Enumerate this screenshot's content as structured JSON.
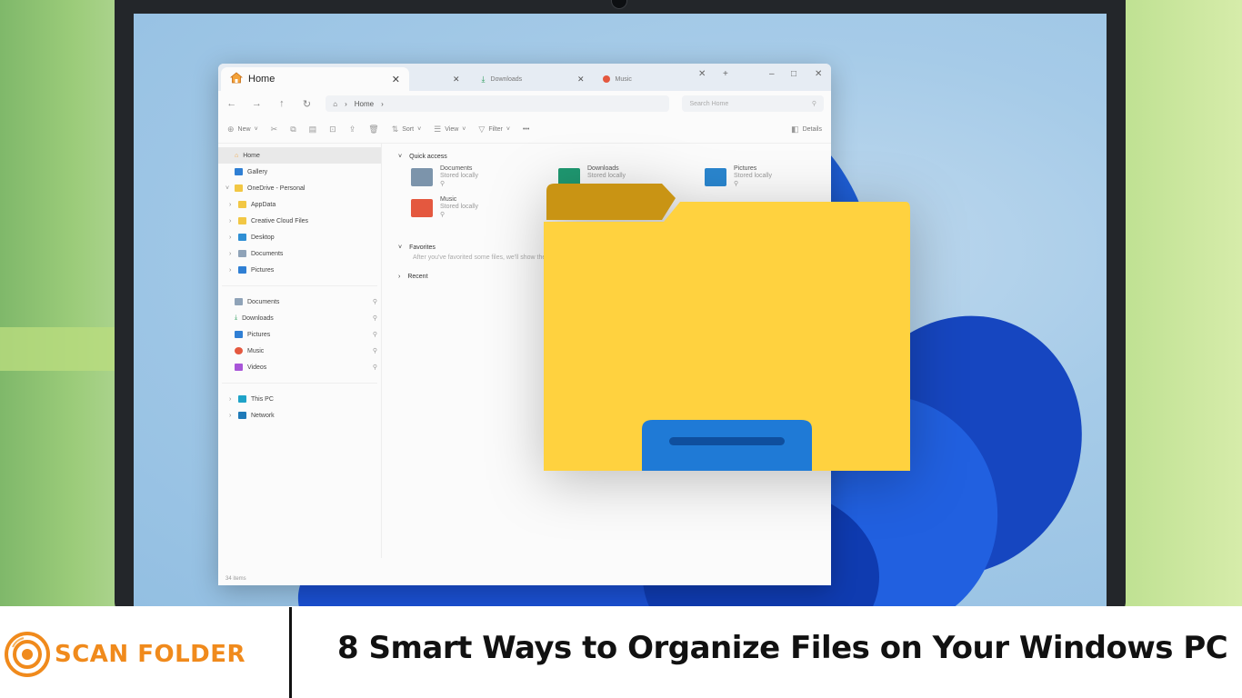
{
  "explorer": {
    "tabs": [
      {
        "label": "Home",
        "active": true
      },
      {
        "label": "Downloads"
      },
      {
        "label": "Music"
      }
    ],
    "window_controls": {
      "minimize": "–",
      "maximize": "□",
      "close": "✕"
    },
    "address": {
      "root": "Home"
    },
    "search_placeholder": "Search Home",
    "commands": {
      "new": "New",
      "sort": "Sort",
      "view": "View",
      "filter": "Filter",
      "more": "•••",
      "details": "Details"
    },
    "nav": {
      "home": "Home",
      "gallery": "Gallery",
      "onedrive": "OneDrive - Personal",
      "appdata": "AppData",
      "creative_cloud": "Creative Cloud Files",
      "desktop": "Desktop",
      "documents": "Documents",
      "pictures": "Pictures",
      "pinned": [
        "Documents",
        "Downloads",
        "Pictures",
        "Music",
        "Videos"
      ],
      "this_pc": "This PC",
      "network": "Network"
    },
    "content": {
      "quick_access": "Quick access",
      "items": [
        {
          "name": "Documents",
          "sub": "Stored locally"
        },
        {
          "name": "Downloads",
          "sub": "Stored locally"
        },
        {
          "name": "Pictures",
          "sub": "Stored locally"
        },
        {
          "name": "Music",
          "sub": "Stored locally"
        }
      ],
      "favorites": "Favorites",
      "favorites_hint": "After you've favorited some files, we'll show them here.",
      "recent": "Recent"
    },
    "status": "34 items"
  },
  "banner": {
    "logo_text": "SCAN FOLDER",
    "headline": "8 Smart Ways to Organize Files on Your Windows PC"
  },
  "colors": {
    "accent_orange": "#f08a1c",
    "folder_yellow": "#ffd23f",
    "folder_tab": "#c99414",
    "folder_pocket": "#1f7ad6",
    "bloom_blue": "#1f5fd8"
  }
}
